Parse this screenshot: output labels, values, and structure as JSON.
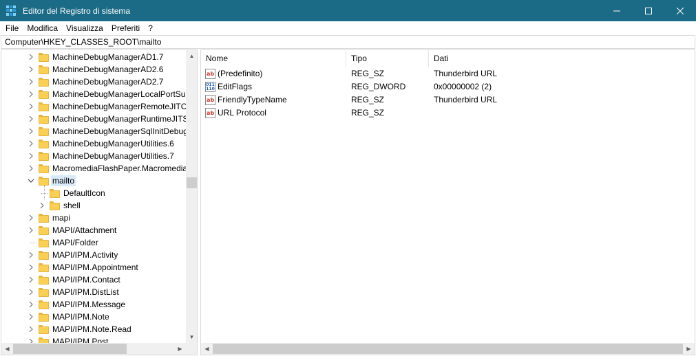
{
  "window": {
    "title": "Editor del Registro di sistema",
    "icon": "registry-editor-icon",
    "controls": {
      "minimize": "—",
      "maximize": "☐",
      "close": "✕"
    },
    "titlebar_color": "#1b6a86"
  },
  "menu": [
    "File",
    "Modifica",
    "Visualizza",
    "Preferiti",
    "?"
  ],
  "address": "Computer\\HKEY_CLASSES_ROOT\\mailto",
  "tree": [
    {
      "label": "MachineDebugManagerAD1.7",
      "expander": "collapsed"
    },
    {
      "label": "MachineDebugManagerAD2.6",
      "expander": "collapsed"
    },
    {
      "label": "MachineDebugManagerAD2.7",
      "expander": "collapsed"
    },
    {
      "label": "MachineDebugManagerLocalPortSup",
      "expander": "collapsed"
    },
    {
      "label": "MachineDebugManagerRemoteJITCI",
      "expander": "collapsed"
    },
    {
      "label": "MachineDebugManagerRuntimeJITS",
      "expander": "collapsed"
    },
    {
      "label": "MachineDebugManagerSqlInitDebug",
      "expander": "collapsed"
    },
    {
      "label": "MachineDebugManagerUtilities.6",
      "expander": "collapsed"
    },
    {
      "label": "MachineDebugManagerUtilities.7",
      "expander": "collapsed"
    },
    {
      "label": "MacromediaFlashPaper.Macromedia",
      "expander": "collapsed"
    },
    {
      "label": "mailto",
      "expander": "expanded",
      "selected": true
    },
    {
      "label": "DefaultIcon",
      "expander": "none",
      "child": true
    },
    {
      "label": "shell",
      "expander": "collapsed",
      "child": true
    },
    {
      "label": "mapi",
      "expander": "collapsed"
    },
    {
      "label": "MAPI/Attachment",
      "expander": "collapsed"
    },
    {
      "label": "MAPI/Folder",
      "expander": "none"
    },
    {
      "label": "MAPI/IPM.Activity",
      "expander": "collapsed"
    },
    {
      "label": "MAPI/IPM.Appointment",
      "expander": "collapsed"
    },
    {
      "label": "MAPI/IPM.Contact",
      "expander": "collapsed"
    },
    {
      "label": "MAPI/IPM.DistList",
      "expander": "collapsed"
    },
    {
      "label": "MAPI/IPM.Message",
      "expander": "collapsed"
    },
    {
      "label": "MAPI/IPM.Note",
      "expander": "collapsed"
    },
    {
      "label": "MAPI/IPM.Note.Read",
      "expander": "collapsed"
    },
    {
      "label": "MAPI/IPM.Post",
      "expander": "collapsed"
    }
  ],
  "list": {
    "columns": [
      "Nome",
      "Tipo",
      "Dati"
    ],
    "rows": [
      {
        "icon": "string-value-icon",
        "icon_text": "ab",
        "name": "(Predefinito)",
        "type": "REG_SZ",
        "data": "Thunderbird URL"
      },
      {
        "icon": "binary-value-icon",
        "icon_text": "011\n110",
        "name": "EditFlags",
        "type": "REG_DWORD",
        "data": "0x00000002 (2)"
      },
      {
        "icon": "string-value-icon",
        "icon_text": "ab",
        "name": "FriendlyTypeName",
        "type": "REG_SZ",
        "data": "Thunderbird URL"
      },
      {
        "icon": "string-value-icon",
        "icon_text": "ab",
        "name": "URL Protocol",
        "type": "REG_SZ",
        "data": ""
      }
    ]
  }
}
